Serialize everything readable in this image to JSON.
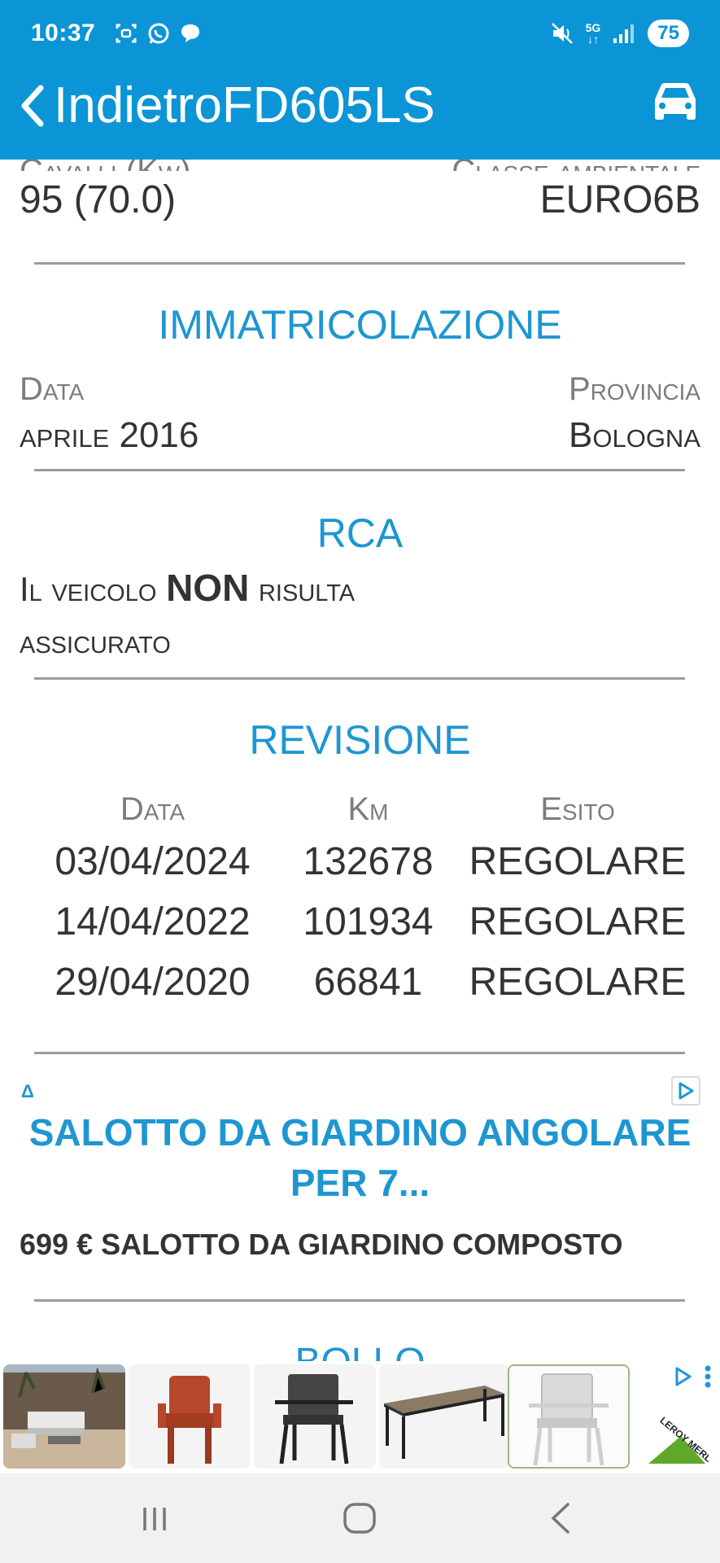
{
  "status": {
    "time": "10:37",
    "network": "5G",
    "battery": "75"
  },
  "appbar": {
    "back_label": "Indietro",
    "plate": "FD605LS"
  },
  "top_partial": {
    "left_label": "Cavalli (Kw)",
    "right_label": "Classe ambientale",
    "left_value": "95 (70.0)",
    "right_value": "EURO6B"
  },
  "immatricolazione": {
    "title": "IMMATRICOLAZIONE",
    "data_label": "Data",
    "provincia_label": "Provincia",
    "data_value": "aprile 2016",
    "provincia_value": "Bologna"
  },
  "rca": {
    "title": "RCA",
    "text_before": "Il veicolo ",
    "text_bold": "NON",
    "text_after": " risulta",
    "text_line2": "assicurato"
  },
  "revisione": {
    "title": "REVISIONE",
    "headers": [
      "Data",
      "Km",
      "Esito"
    ],
    "rows": [
      [
        "03/04/2024",
        "132678",
        "REGOLARE"
      ],
      [
        "14/04/2022",
        "101934",
        "REGOLARE"
      ],
      [
        "29/04/2020",
        "66841",
        "REGOLARE"
      ]
    ]
  },
  "ad": {
    "choice_mark": "Δ",
    "title": "SALOTTO DA GIARDINO ANGOLARE PER 7...",
    "description": "699 € SALOTTO DA GIARDINO COMPOSTO"
  },
  "bollo": {
    "title": "BOLLO"
  },
  "banner": {
    "brand": "LEROY MERLIN"
  },
  "colors": {
    "accent": "#1e96d2",
    "appbar": "#0b95d6",
    "text": "#333333",
    "label": "#7c7c7c"
  }
}
